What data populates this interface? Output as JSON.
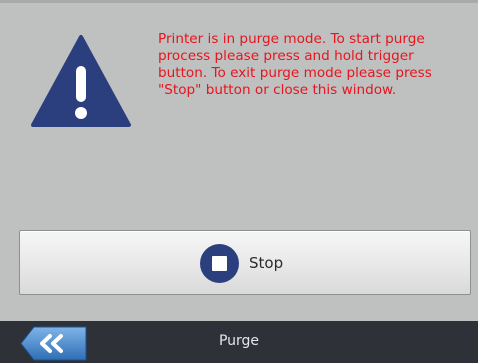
{
  "dialog": {
    "message": "Printer is in purge mode. To start purge\nprocess please press and hold trigger\nbutton. To exit purge mode please press\n\"Stop\" button or close this window.",
    "icon": "warning-icon"
  },
  "stop_button": {
    "label": "Stop",
    "icon": "stop-icon"
  },
  "footer": {
    "title": "Purge",
    "back_icon": "double-chevron-left-icon"
  },
  "colors": {
    "background": "#bfc1c0",
    "message_text": "#e8141e",
    "accent_blue": "#2b3f7e",
    "footer_bg": "#2e3238"
  }
}
